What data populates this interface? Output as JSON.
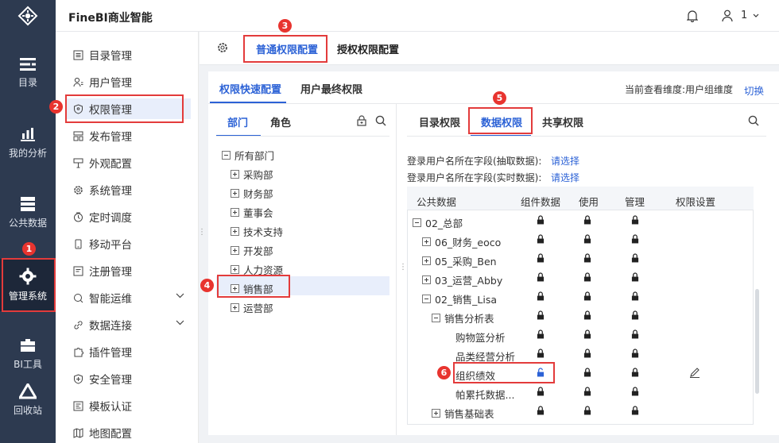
{
  "app": {
    "title": "FineBI商业智能",
    "user_label": "1"
  },
  "rail": {
    "items": [
      "目录",
      "我的分析",
      "公共数据",
      "管理系统",
      "BI工具",
      "回收站"
    ]
  },
  "menu": {
    "items": [
      "目录管理",
      "用户管理",
      "权限管理",
      "发布管理",
      "外观配置",
      "系统管理",
      "定时调度",
      "移动平台",
      "注册管理",
      "智能运维",
      "数据连接",
      "插件管理",
      "安全管理",
      "模板认证",
      "地图配置"
    ]
  },
  "tabs_top": [
    "普通权限配置",
    "授权权限配置"
  ],
  "tabs_sub": [
    "权限快速配置",
    "用户最终权限"
  ],
  "dimension_text": "当前查看维度:用户组维度",
  "switch_label": "切换",
  "left_tabs": [
    "部门",
    "角色"
  ],
  "dept_tree": {
    "root": "所有部门",
    "children": [
      "采购部",
      "财务部",
      "董事会",
      "技术支持",
      "开发部",
      "人力资源",
      "销售部",
      "运营部"
    ]
  },
  "right_tabs": [
    "目录权限",
    "数据权限",
    "共享权限"
  ],
  "login_fields": [
    {
      "label": "登录用户名所在字段(抽取数据):",
      "link": "请选择"
    },
    {
      "label": "登录用户名所在字段(实时数据):",
      "link": "请选择"
    }
  ],
  "table_headers": [
    "公共数据",
    "组件数据",
    "使用",
    "管理",
    "权限设置"
  ],
  "table_rows": [
    "02_总部",
    "06_财务_eoco",
    "05_采购_Ben",
    "03_运营_Abby",
    "02_销售_Lisa",
    "销售分析表",
    "购物篮分析",
    "品类经营分析",
    "组织绩效",
    "帕累托数据...",
    "销售基础表"
  ],
  "badges": [
    "1",
    "2",
    "3",
    "4",
    "5",
    "6"
  ]
}
